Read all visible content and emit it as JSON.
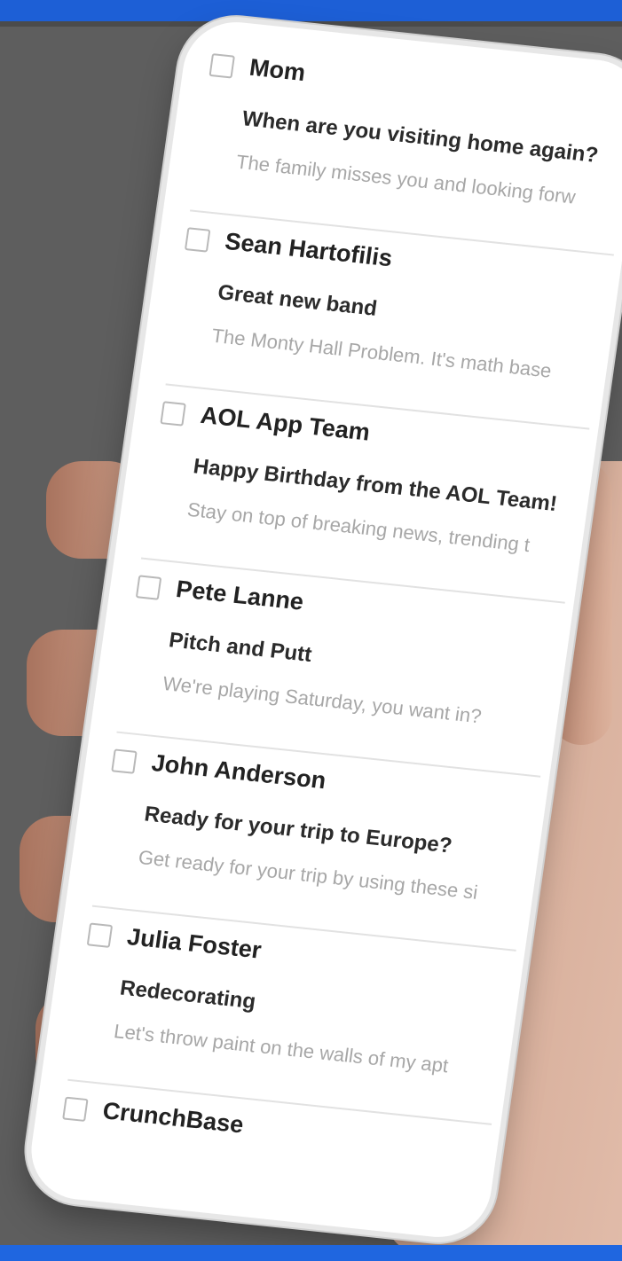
{
  "emails": [
    {
      "sender": "Mom",
      "subject": "When are you visiting home again?",
      "preview": "The family misses you and looking forw"
    },
    {
      "sender": "Sean Hartofilis",
      "subject": "Great new band",
      "preview": "The Monty Hall Problem. It's math base"
    },
    {
      "sender": "AOL App Team",
      "subject": "Happy Birthday from the AOL Team!",
      "preview": "Stay on top of breaking news, trending t"
    },
    {
      "sender": "Pete Lanne",
      "subject": "Pitch and Putt",
      "preview": "We're playing Saturday, you want in?"
    },
    {
      "sender": "John Anderson",
      "subject": "Ready for your trip to Europe?",
      "preview": "Get ready for your trip by using these si"
    },
    {
      "sender": "Julia Foster",
      "subject": "Redecorating",
      "preview": "Let's throw paint on the walls of my apt"
    },
    {
      "sender": "CrunchBase",
      "subject": "",
      "preview": ""
    }
  ]
}
